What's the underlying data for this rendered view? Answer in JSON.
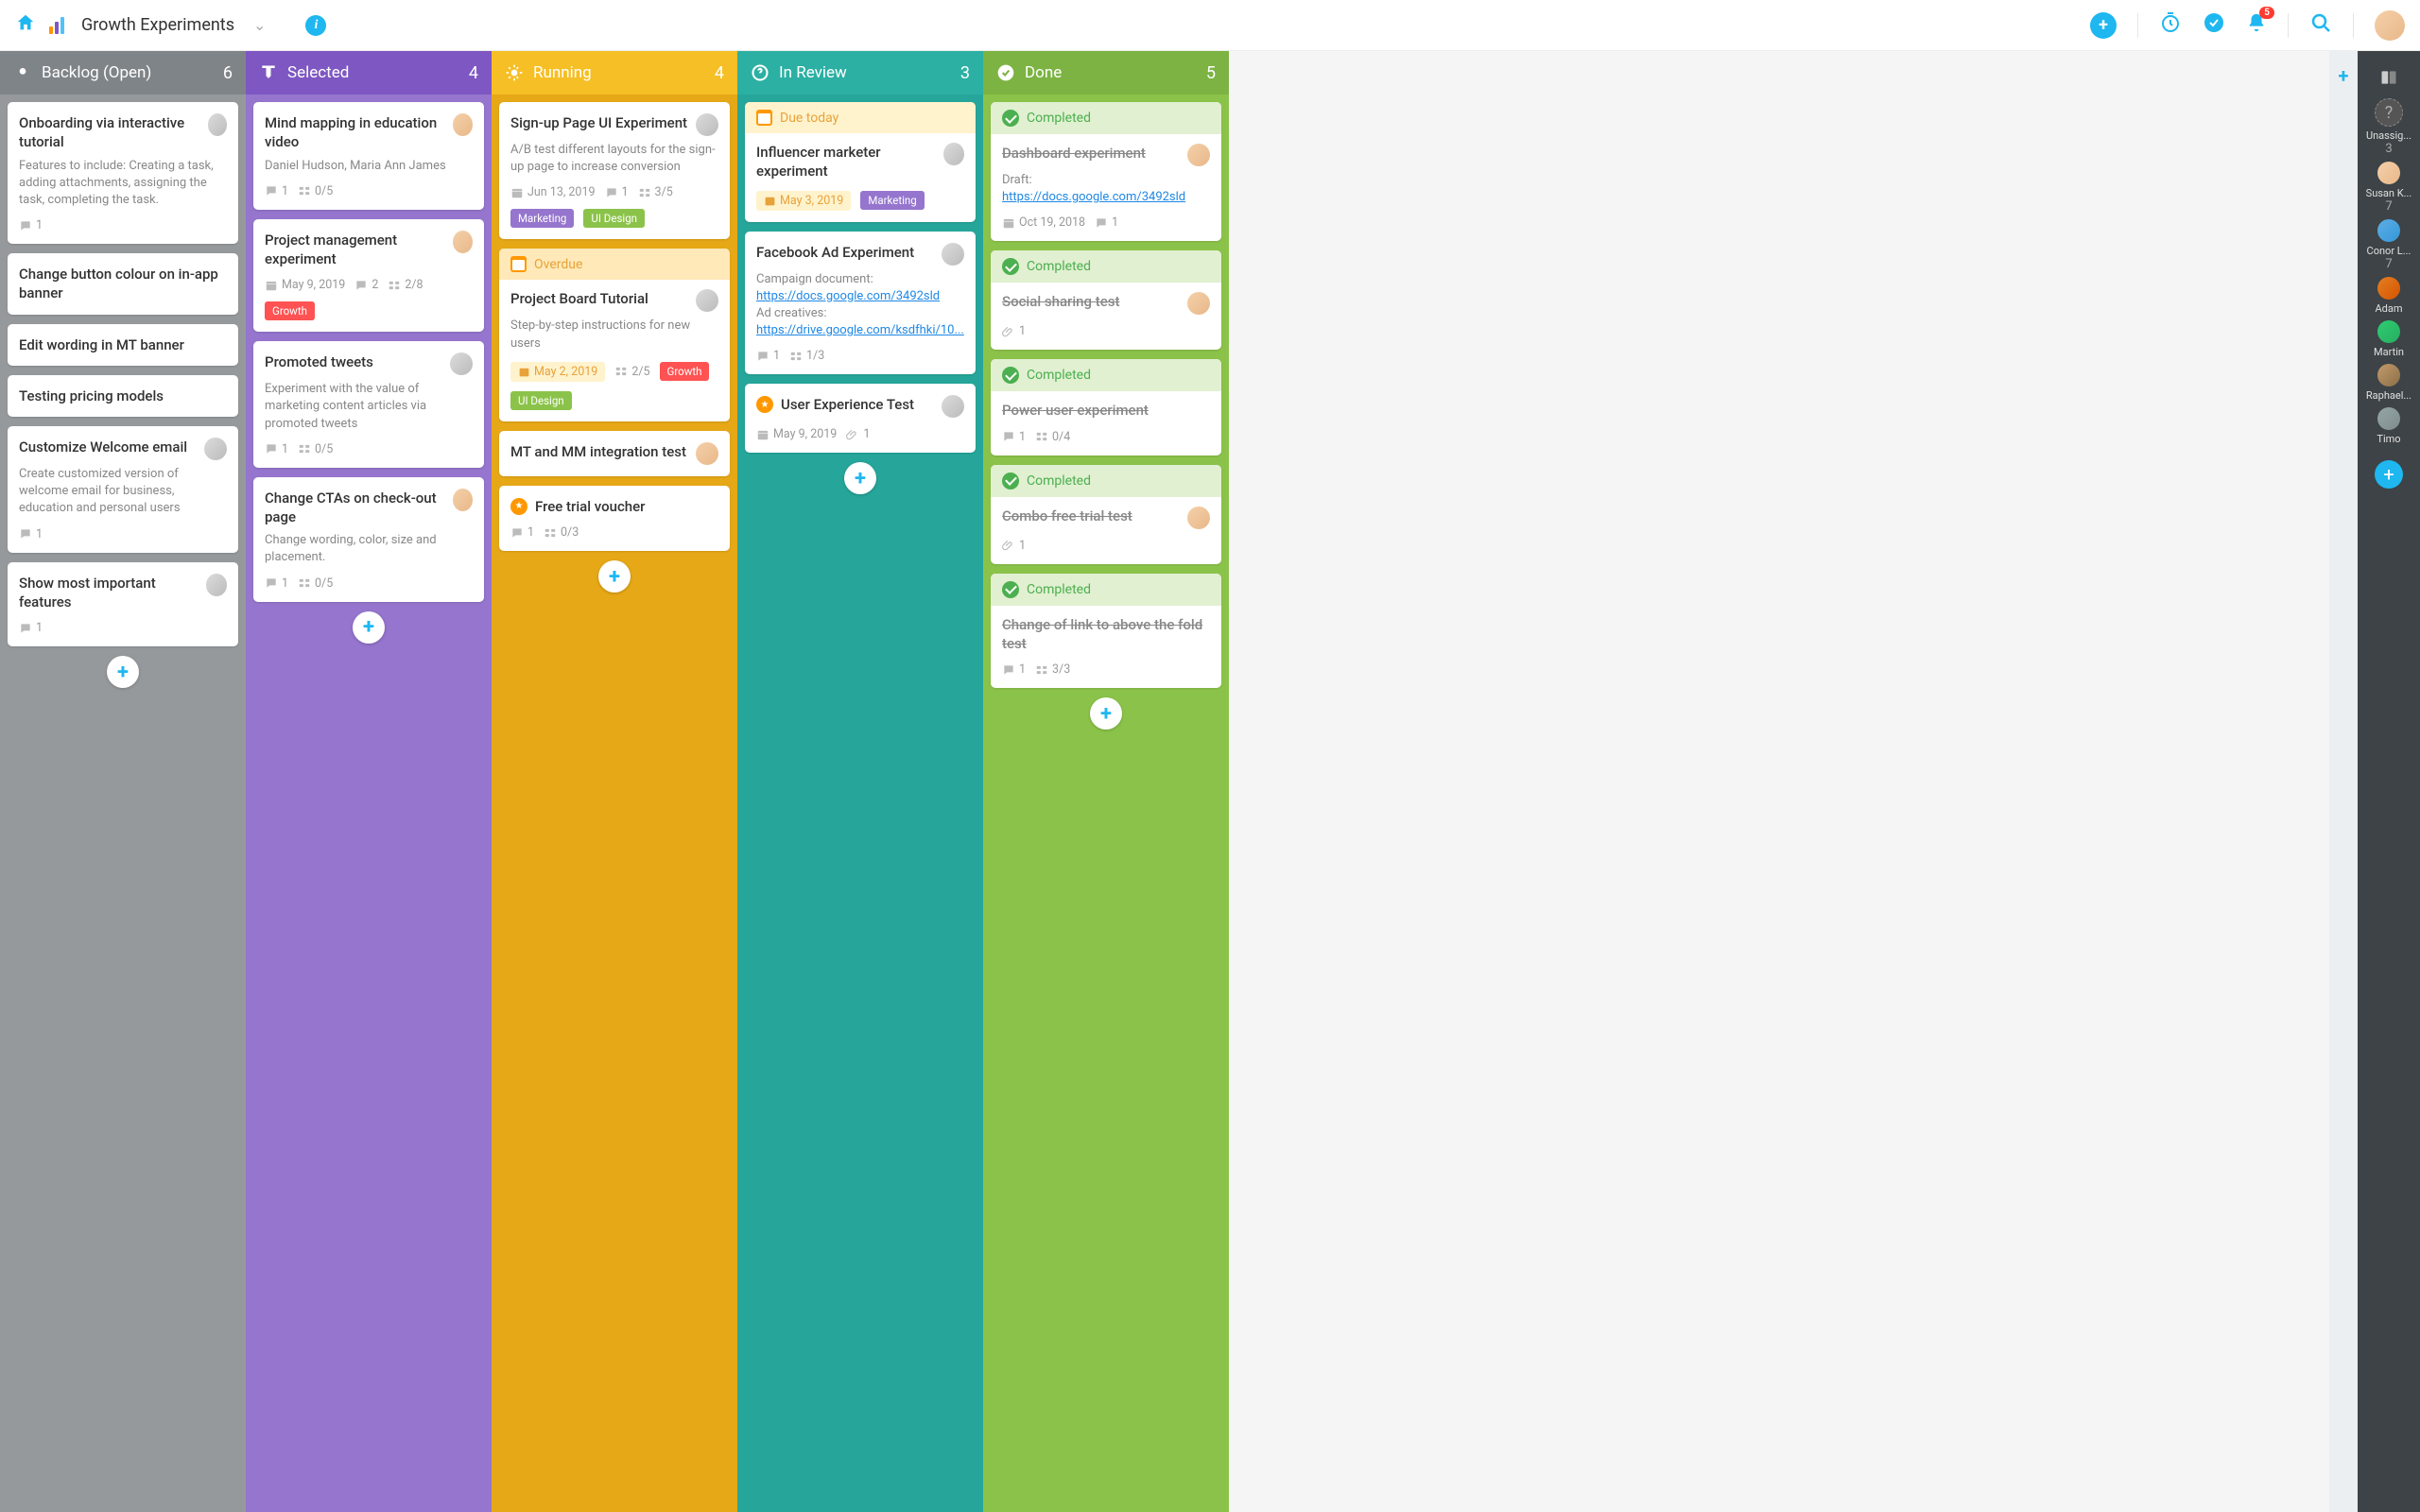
{
  "header": {
    "boardTitle": "Growth Experiments",
    "notifCount": "5"
  },
  "columns": [
    {
      "id": "backlog",
      "title": "Backlog (Open)",
      "count": "6",
      "cards": [
        {
          "title": "Onboarding via interactive tutorial",
          "desc": "Features to include: Creating a task, adding attachments, assigning the task, completing the task.",
          "avatar": "a3",
          "comments": "1"
        },
        {
          "title": "Change button colour on in-app banner"
        },
        {
          "title": "Edit wording in MT banner"
        },
        {
          "title": "Testing pricing models"
        },
        {
          "title": "Customize Welcome email",
          "desc": "Create customized version of welcome email for business, education and personal users",
          "avatar": "a3",
          "comments": "1"
        },
        {
          "title": "Show most important features",
          "avatar": "a3",
          "comments": "1"
        }
      ]
    },
    {
      "id": "selected",
      "title": "Selected",
      "count": "4",
      "cards": [
        {
          "title": "Mind mapping in education video",
          "desc": "Daniel Hudson, Maria Ann James",
          "avatar": "a2",
          "comments": "1",
          "subtasks": "0/5"
        },
        {
          "title": "Project management experiment",
          "avatar": "a2",
          "date": "May 9, 2019",
          "comments": "2",
          "subtasks": "2/8",
          "tags": [
            "Growth"
          ]
        },
        {
          "title": "Promoted tweets",
          "desc": "Experiment with the value of marketing content articles via promoted tweets",
          "avatar": "a3",
          "comments": "1",
          "subtasks": "0/5"
        },
        {
          "title": "Change CTAs on check-out page",
          "desc": "Change wording, color, size and placement.",
          "avatar": "a2",
          "comments": "1",
          "subtasks": "0/5"
        }
      ]
    },
    {
      "id": "running",
      "title": "Running",
      "count": "4",
      "cards": [
        {
          "title": "Sign-up Page UI Experiment",
          "desc": "A/B test different layouts for the sign-up page to increase conversion",
          "avatar": "a3",
          "date": "Jun 13, 2019",
          "comments": "1",
          "subtasks": "3/5",
          "tags": [
            "Marketing",
            "UI Design"
          ]
        },
        {
          "banner": "Overdue",
          "title": "Project Board Tutorial",
          "desc": "Step-by-step instructions for new users",
          "avatar": "a3",
          "dateChip": "May 2, 2019",
          "subtasks": "2/5",
          "tags": [
            "Growth"
          ],
          "tags2": [
            "UI Design"
          ]
        },
        {
          "title": "MT and MM integration test",
          "avatar": "a2"
        },
        {
          "starBanner": true,
          "title": "Free trial voucher",
          "comments": "1",
          "subtasks": "0/3"
        }
      ]
    },
    {
      "id": "review",
      "title": "In Review",
      "count": "3",
      "cards": [
        {
          "banner": "Due today",
          "title": "Influencer marketer experiment",
          "avatar": "a3",
          "dateChip": "May 3, 2019",
          "tags": [
            "Marketing"
          ]
        },
        {
          "title": "Facebook Ad Experiment",
          "descHtml": "Campaign document:<br><a class='link'>https://docs.google.com/3492sld</a><br>Ad creatives:<br><a class='link'>https://drive.google.com/ksdfhki/10...</a>",
          "avatar": "a3",
          "comments": "1",
          "subtasks": "1/3"
        },
        {
          "starBanner": true,
          "title": "User Experience Test",
          "avatar": "a3",
          "date": "May 9, 2019",
          "attachments": "1"
        }
      ]
    },
    {
      "id": "done",
      "title": "Done",
      "count": "5",
      "cards": [
        {
          "banner": "Completed",
          "title": "Dashboard experiment",
          "strike": true,
          "descHtml": "Draft: <a class='link'>https://docs.google.com/3492sld</a>",
          "avatar": "a2",
          "date": "Oct 19, 2018",
          "comments": "1"
        },
        {
          "banner": "Completed",
          "title": "Social sharing test",
          "strike": true,
          "avatar": "a2",
          "attachments": "1"
        },
        {
          "banner": "Completed",
          "title": "Power user experiment",
          "strike": true,
          "subtasks": "0/4",
          "comments": "1"
        },
        {
          "banner": "Completed",
          "title": "Combo free trial test",
          "strike": true,
          "avatar": "a2",
          "attachments": "1"
        },
        {
          "banner": "Completed",
          "title": "Change of link to above the fold test",
          "strike": true,
          "subtasks": "3/3",
          "comments": "1"
        }
      ]
    }
  ],
  "sidebar": {
    "users": [
      {
        "name": "Unassig...",
        "count": "3",
        "placeholder": true
      },
      {
        "name": "Susan K...",
        "count": "7",
        "av": "a2"
      },
      {
        "name": "Conor L...",
        "count": "7",
        "av": "a4"
      },
      {
        "name": "Adam",
        "av": "a6"
      },
      {
        "name": "Martin",
        "av": "a5"
      },
      {
        "name": "Raphael...",
        "av": "a1"
      },
      {
        "name": "Timo",
        "av": "a7"
      }
    ]
  }
}
